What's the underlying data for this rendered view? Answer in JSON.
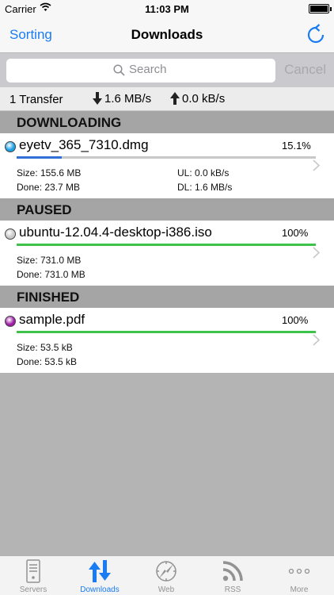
{
  "status_bar": {
    "carrier": "Carrier",
    "time": "11:03 PM"
  },
  "nav": {
    "left_button": "Sorting",
    "title": "Downloads",
    "right_icon": "refresh-icon"
  },
  "search": {
    "placeholder": "Search",
    "cancel_label": "Cancel"
  },
  "summary": {
    "transfers": "1 Transfer",
    "download_rate": "1.6 MB/s",
    "upload_rate": "0.0 kB/s"
  },
  "sections": [
    {
      "header": "DOWNLOADING",
      "items": [
        {
          "name": "eyetv_365_7310.dmg",
          "percent": "15.1%",
          "progress": 0.151,
          "dot_color": "#1aa0e6",
          "bar_color": "#2f6fd6",
          "size": "Size: 155.6 MB",
          "done": "Done: 23.7 MB",
          "ul": "UL: 0.0 kB/s",
          "dl": "DL: 1.6 MB/s"
        }
      ]
    },
    {
      "header": "PAUSED",
      "items": [
        {
          "name": "ubuntu-12.04.4-desktop-i386.iso",
          "percent": "100%",
          "progress": 1.0,
          "dot_color": "#c8c8c8",
          "bar_color": "#3fc24a",
          "size": "Size: 731.0 MB",
          "done": "Done: 731.0 MB"
        }
      ]
    },
    {
      "header": "FINISHED",
      "items": [
        {
          "name": "sample.pdf",
          "percent": "100%",
          "progress": 1.0,
          "dot_color": "#a01aa8",
          "bar_color": "#3fc24a",
          "size": "Size: 53.5 kB",
          "done": "Done: 53.5 kB"
        }
      ]
    }
  ],
  "tabs": [
    {
      "label": "Servers",
      "icon": "servers-icon",
      "active": false
    },
    {
      "label": "Downloads",
      "icon": "downloads-icon",
      "active": true
    },
    {
      "label": "Web",
      "icon": "web-icon",
      "active": false
    },
    {
      "label": "RSS",
      "icon": "rss-icon",
      "active": false
    },
    {
      "label": "More",
      "icon": "more-icon",
      "active": false
    }
  ],
  "colors": {
    "accent": "#1a7cf5",
    "section_header": "#a5a5a5",
    "background": "#b4b4b4"
  }
}
